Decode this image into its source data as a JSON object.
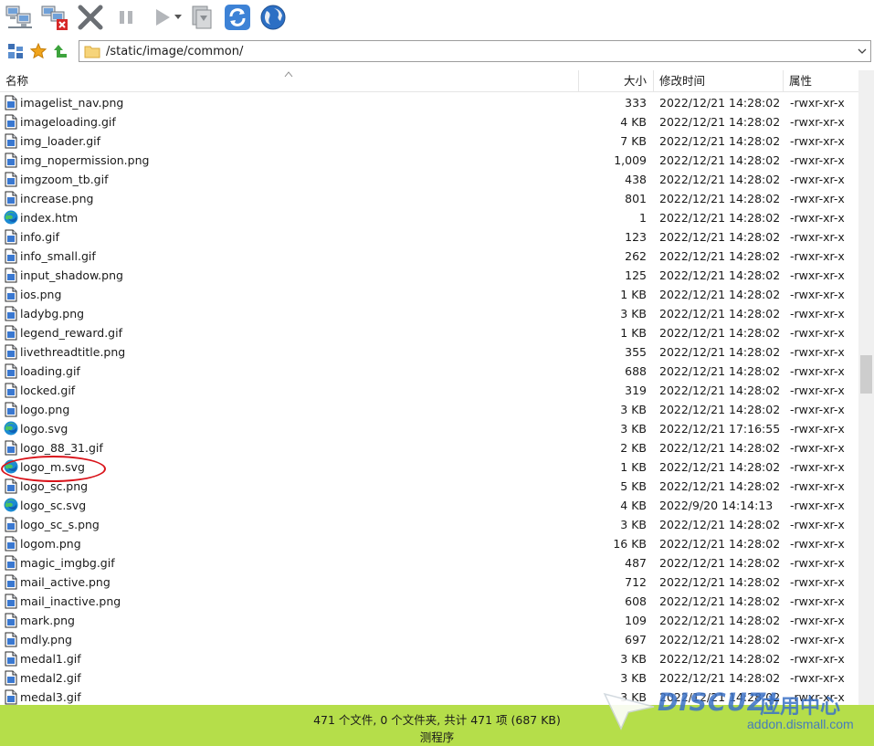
{
  "address": {
    "path": "/static/image/common/"
  },
  "columns": {
    "name": "名称",
    "size": "大小",
    "modified": "修改时间",
    "attributes": "属性"
  },
  "files": [
    {
      "name": "imagelist_nav.png",
      "size": "333",
      "date": "2022/12/21 14:28:02",
      "perm": "-rwxr-xr-x",
      "icon": "file-icon"
    },
    {
      "name": "imageloading.gif",
      "size": "4 KB",
      "date": "2022/12/21 14:28:02",
      "perm": "-rwxr-xr-x",
      "icon": "file-icon"
    },
    {
      "name": "img_loader.gif",
      "size": "7 KB",
      "date": "2022/12/21 14:28:02",
      "perm": "-rwxr-xr-x",
      "icon": "file-icon"
    },
    {
      "name": "img_nopermission.png",
      "size": "1,009",
      "date": "2022/12/21 14:28:02",
      "perm": "-rwxr-xr-x",
      "icon": "file-icon"
    },
    {
      "name": "imgzoom_tb.gif",
      "size": "438",
      "date": "2022/12/21 14:28:02",
      "perm": "-rwxr-xr-x",
      "icon": "file-icon"
    },
    {
      "name": "increase.png",
      "size": "801",
      "date": "2022/12/21 14:28:02",
      "perm": "-rwxr-xr-x",
      "icon": "file-icon"
    },
    {
      "name": "index.htm",
      "size": "1",
      "date": "2022/12/21 14:28:02",
      "perm": "-rwxr-xr-x",
      "icon": "edge-icon"
    },
    {
      "name": "info.gif",
      "size": "123",
      "date": "2022/12/21 14:28:02",
      "perm": "-rwxr-xr-x",
      "icon": "file-icon"
    },
    {
      "name": "info_small.gif",
      "size": "262",
      "date": "2022/12/21 14:28:02",
      "perm": "-rwxr-xr-x",
      "icon": "file-icon"
    },
    {
      "name": "input_shadow.png",
      "size": "125",
      "date": "2022/12/21 14:28:02",
      "perm": "-rwxr-xr-x",
      "icon": "file-icon"
    },
    {
      "name": "ios.png",
      "size": "1 KB",
      "date": "2022/12/21 14:28:02",
      "perm": "-rwxr-xr-x",
      "icon": "file-icon"
    },
    {
      "name": "ladybg.png",
      "size": "3 KB",
      "date": "2022/12/21 14:28:02",
      "perm": "-rwxr-xr-x",
      "icon": "file-icon"
    },
    {
      "name": "legend_reward.gif",
      "size": "1 KB",
      "date": "2022/12/21 14:28:02",
      "perm": "-rwxr-xr-x",
      "icon": "file-icon"
    },
    {
      "name": "livethreadtitle.png",
      "size": "355",
      "date": "2022/12/21 14:28:02",
      "perm": "-rwxr-xr-x",
      "icon": "file-icon"
    },
    {
      "name": "loading.gif",
      "size": "688",
      "date": "2022/12/21 14:28:02",
      "perm": "-rwxr-xr-x",
      "icon": "file-icon"
    },
    {
      "name": "locked.gif",
      "size": "319",
      "date": "2022/12/21 14:28:02",
      "perm": "-rwxr-xr-x",
      "icon": "file-icon"
    },
    {
      "name": "logo.png",
      "size": "3 KB",
      "date": "2022/12/21 14:28:02",
      "perm": "-rwxr-xr-x",
      "icon": "file-icon"
    },
    {
      "name": "logo.svg",
      "size": "3 KB",
      "date": "2022/12/21 17:16:55",
      "perm": "-rwxr-xr-x",
      "icon": "edge-icon"
    },
    {
      "name": "logo_88_31.gif",
      "size": "2 KB",
      "date": "2022/12/21 14:28:02",
      "perm": "-rwxr-xr-x",
      "icon": "file-icon"
    },
    {
      "name": "logo_m.svg",
      "size": "1 KB",
      "date": "2022/12/21 14:28:02",
      "perm": "-rwxr-xr-x",
      "icon": "edge-icon"
    },
    {
      "name": "logo_sc.png",
      "size": "5 KB",
      "date": "2022/12/21 14:28:02",
      "perm": "-rwxr-xr-x",
      "icon": "file-icon"
    },
    {
      "name": "logo_sc.svg",
      "size": "4 KB",
      "date": "2022/9/20 14:14:13",
      "perm": "-rwxr-xr-x",
      "icon": "edge-icon"
    },
    {
      "name": "logo_sc_s.png",
      "size": "3 KB",
      "date": "2022/12/21 14:28:02",
      "perm": "-rwxr-xr-x",
      "icon": "file-icon"
    },
    {
      "name": "logom.png",
      "size": "16 KB",
      "date": "2022/12/21 14:28:02",
      "perm": "-rwxr-xr-x",
      "icon": "file-icon"
    },
    {
      "name": "magic_imgbg.gif",
      "size": "487",
      "date": "2022/12/21 14:28:02",
      "perm": "-rwxr-xr-x",
      "icon": "file-icon"
    },
    {
      "name": "mail_active.png",
      "size": "712",
      "date": "2022/12/21 14:28:02",
      "perm": "-rwxr-xr-x",
      "icon": "file-icon"
    },
    {
      "name": "mail_inactive.png",
      "size": "608",
      "date": "2022/12/21 14:28:02",
      "perm": "-rwxr-xr-x",
      "icon": "file-icon"
    },
    {
      "name": "mark.png",
      "size": "109",
      "date": "2022/12/21 14:28:02",
      "perm": "-rwxr-xr-x",
      "icon": "file-icon"
    },
    {
      "name": "mdly.png",
      "size": "697",
      "date": "2022/12/21 14:28:02",
      "perm": "-rwxr-xr-x",
      "icon": "file-icon"
    },
    {
      "name": "medal1.gif",
      "size": "3 KB",
      "date": "2022/12/21 14:28:02",
      "perm": "-rwxr-xr-x",
      "icon": "file-icon"
    },
    {
      "name": "medal2.gif",
      "size": "3 KB",
      "date": "2022/12/21 14:28:02",
      "perm": "-rwxr-xr-x",
      "icon": "file-icon"
    },
    {
      "name": "medal3.gif",
      "size": "3 KB",
      "date": "2022/12/21 14:28:02",
      "perm": "-rwxr-xr-x",
      "icon": "file-icon"
    }
  ],
  "status": {
    "summary": "471 个文件, 0 个文件夹, 共计 471 项 (687 KB)",
    "label": "测程序"
  },
  "watermark": {
    "brand": "DISCUZ!",
    "cn": "应用中心",
    "url": "addon.dismall.com"
  },
  "colors": {
    "status_bg": "#b5de4a",
    "highlight": "#d9141b",
    "watermark": "#3b72c7"
  }
}
